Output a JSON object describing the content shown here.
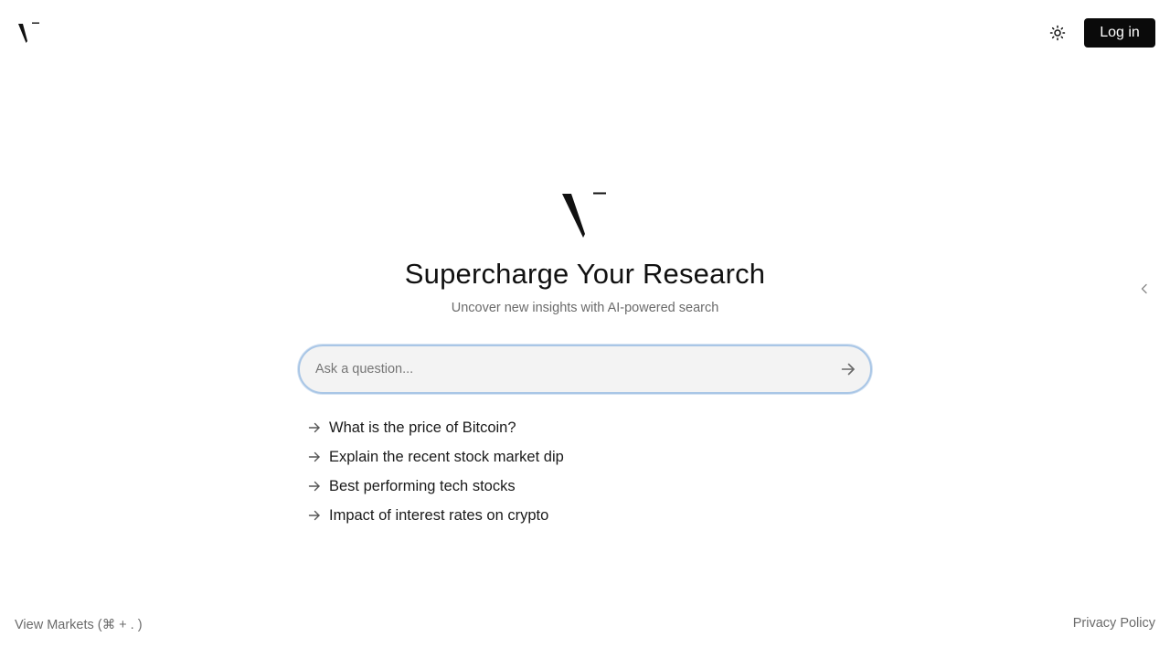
{
  "header": {
    "logo_icon": "v-logo-icon",
    "theme_icon": "sun-icon",
    "login_label": "Log in"
  },
  "hero": {
    "logo_icon": "v-logo-icon",
    "title": "Supercharge Your Research",
    "subtitle": "Uncover new insights with AI-powered search"
  },
  "sidebar_toggle": {
    "icon": "chevron-left-icon"
  },
  "search": {
    "value": "",
    "placeholder": "Ask a question...",
    "submit_icon": "arrow-right-icon"
  },
  "suggestions": [
    {
      "label": "What is the price of Bitcoin?",
      "icon": "arrow-right-icon"
    },
    {
      "label": "Explain the recent stock market dip",
      "icon": "arrow-right-icon"
    },
    {
      "label": "Best performing tech stocks",
      "icon": "arrow-right-icon"
    },
    {
      "label": "Impact of interest rates on crypto",
      "icon": "arrow-right-icon"
    }
  ],
  "footer": {
    "markets_label": "View Markets (⌘ + . )",
    "privacy_label": "Privacy Policy"
  },
  "colors": {
    "accent_border": "#a9c6e6",
    "button_bg": "#0a0a0a",
    "muted_text": "#6b6b6b"
  }
}
